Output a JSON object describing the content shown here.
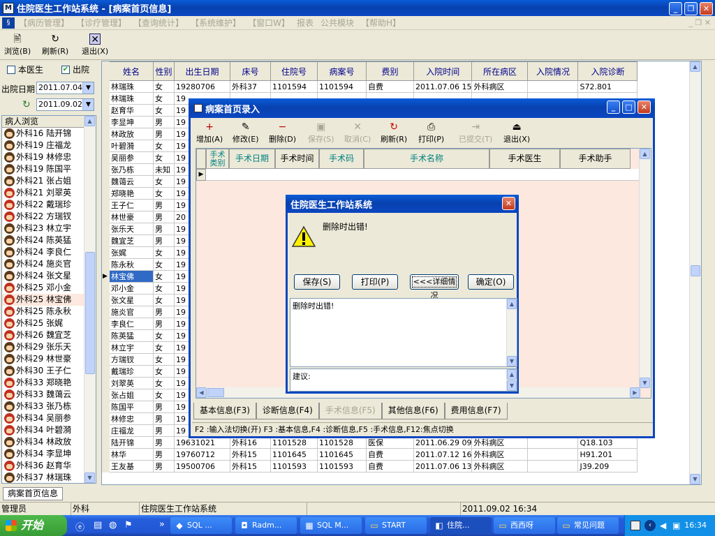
{
  "app": {
    "title": "住院医生工作站系统 - [病案首页信息]",
    "menu": [
      "【病历管理】",
      "【诊疗管理】",
      "【查询统计】",
      "【系统维护】",
      "【窗口W】",
      "报表",
      "公共模块",
      "【帮助H】"
    ],
    "toolbar": [
      {
        "label": "浏览(B)",
        "icon": "browse-icon"
      },
      {
        "label": "刷新(R)",
        "icon": "refresh-icon"
      },
      {
        "label": "退出(X)",
        "icon": "exit-icon"
      }
    ]
  },
  "filter": {
    "doctor_label": "本医生",
    "discharge_label": "出院",
    "date_label": "出院日期",
    "date_from": "2011.07.04",
    "date_to": "2011.09.02"
  },
  "patient_list": {
    "header": "病人浏览",
    "items": [
      {
        "text": "外科16 陆开锦",
        "f": false
      },
      {
        "text": "外科19 庄福龙",
        "f": false
      },
      {
        "text": "外科19 林修忠",
        "f": false
      },
      {
        "text": "外科19 陈国平",
        "f": false
      },
      {
        "text": "外科21 张占姐",
        "f": false
      },
      {
        "text": "外科21 刘翠英",
        "f": true
      },
      {
        "text": "外科22 戴瑞珍",
        "f": true
      },
      {
        "text": "外科22 方瑞钗",
        "f": true
      },
      {
        "text": "外科23 林立宇",
        "f": false
      },
      {
        "text": "外科24 陈英猛",
        "f": false
      },
      {
        "text": "外科24 李良仁",
        "f": false
      },
      {
        "text": "外科24 施炎官",
        "f": false
      },
      {
        "text": "外科24 张文星",
        "f": false
      },
      {
        "text": "外科25 邓小金",
        "f": true
      },
      {
        "text": "外科25 林宝佛",
        "f": true
      },
      {
        "text": "外科25 陈永秋",
        "f": true
      },
      {
        "text": "外科25 张娓",
        "f": true
      },
      {
        "text": "外科26 魏宜芝",
        "f": true
      },
      {
        "text": "外科29 张乐天",
        "f": false
      },
      {
        "text": "外科29 林世豪",
        "f": false
      },
      {
        "text": "外科30 王子仁",
        "f": false
      },
      {
        "text": "外科33 郑晓艳",
        "f": true
      },
      {
        "text": "外科33 魏蔼云",
        "f": true
      },
      {
        "text": "外科33 张乃栋",
        "f": false
      },
      {
        "text": "外科34 吴丽参",
        "f": true
      },
      {
        "text": "外科34 叶碧漪",
        "f": true
      },
      {
        "text": "外科34 林政放",
        "f": false
      },
      {
        "text": "外科34 李显坤",
        "f": false
      },
      {
        "text": "外科36 赵育华",
        "f": true
      },
      {
        "text": "外科37 林瑞珠",
        "f": false
      }
    ]
  },
  "grid": {
    "columns": [
      "姓名",
      "性别",
      "出生日期",
      "床号",
      "住院号",
      "病案号",
      "费别",
      "入院时间",
      "所在病区",
      "入院情况",
      "入院诊断"
    ],
    "selected_index": 14,
    "rows": [
      [
        "林瑞珠",
        "女",
        "19280706",
        "外科37",
        "1101594",
        "1101594",
        "自费",
        "2011.07.06 15",
        "外科病区",
        "",
        "S72.801"
      ],
      [
        "林瑞珠",
        "女",
        "19",
        "",
        "",
        "",
        "",
        "",
        "",
        "",
        ""
      ],
      [
        "赵育华",
        "女",
        "19",
        "",
        "",
        "",
        "",
        "",
        "",
        "",
        ""
      ],
      [
        "李显坤",
        "男",
        "19",
        "",
        "",
        "",
        "",
        "",
        "",
        "",
        ""
      ],
      [
        "林政放",
        "男",
        "19",
        "",
        "",
        "",
        "",
        "",
        "",
        "",
        ""
      ],
      [
        "叶碧漪",
        "女",
        "19",
        "",
        "",
        "",
        "",
        "",
        "",
        "",
        ""
      ],
      [
        "吴丽参",
        "女",
        "19",
        "",
        "",
        "",
        "",
        "",
        "",
        "",
        ""
      ],
      [
        "张乃栋",
        "未知",
        "19",
        "",
        "",
        "",
        "",
        "",
        "",
        "",
        ""
      ],
      [
        "魏蔼云",
        "女",
        "19",
        "",
        "",
        "",
        "",
        "",
        "",
        "",
        ""
      ],
      [
        "郑晓艳",
        "女",
        "19",
        "",
        "",
        "",
        "",
        "",
        "",
        "",
        ""
      ],
      [
        "王子仁",
        "男",
        "19",
        "",
        "",
        "",
        "",
        "",
        "",
        "",
        ""
      ],
      [
        "林世豪",
        "男",
        "20",
        "",
        "",
        "",
        "",
        "",
        "",
        "",
        ""
      ],
      [
        "张乐天",
        "男",
        "19",
        "",
        "",
        "",
        "",
        "",
        "",
        "",
        ""
      ],
      [
        "魏宜芝",
        "男",
        "19",
        "",
        "",
        "",
        "",
        "",
        "",
        "",
        ""
      ],
      [
        "张娓",
        "女",
        "19",
        "",
        "",
        "",
        "",
        "",
        "",
        "",
        ""
      ],
      [
        "陈永秋",
        "女",
        "19",
        "",
        "",
        "",
        "",
        "",
        "",
        "",
        ""
      ],
      [
        "林宝佛",
        "女",
        "19",
        "",
        "",
        "",
        "",
        "",
        "",
        "",
        ""
      ],
      [
        "邓小金",
        "女",
        "19",
        "",
        "",
        "",
        "",
        "",
        "",
        "",
        ""
      ],
      [
        "张文星",
        "女",
        "19",
        "",
        "",
        "",
        "",
        "",
        "",
        "",
        ""
      ],
      [
        "施炎官",
        "男",
        "19",
        "",
        "",
        "",
        "",
        "",
        "",
        "",
        ""
      ],
      [
        "李良仁",
        "男",
        "19",
        "",
        "",
        "",
        "",
        "",
        "",
        "",
        ""
      ],
      [
        "陈英猛",
        "女",
        "19",
        "",
        "",
        "",
        "",
        "",
        "",
        "",
        ""
      ],
      [
        "林立宇",
        "女",
        "19",
        "",
        "",
        "",
        "",
        "",
        "",
        "",
        ""
      ],
      [
        "方瑞钗",
        "女",
        "19",
        "",
        "",
        "",
        "",
        "",
        "",
        "",
        ""
      ],
      [
        "戴瑞珍",
        "女",
        "19",
        "",
        "",
        "",
        "",
        "",
        "",
        "",
        ""
      ],
      [
        "刘翠英",
        "女",
        "19",
        "",
        "",
        "",
        "",
        "",
        "",
        "",
        ""
      ],
      [
        "张占姐",
        "女",
        "19",
        "",
        "",
        "",
        "",
        "",
        "",
        "",
        ""
      ],
      [
        "陈国平",
        "男",
        "19",
        "",
        "",
        "",
        "",
        "",
        "",
        "",
        ""
      ],
      [
        "林修忠",
        "男",
        "19",
        "",
        "",
        "",
        "",
        "",
        "",
        "",
        ""
      ],
      [
        "庄福龙",
        "男",
        "19",
        "",
        "",
        "",
        "",
        "",
        "",
        "",
        ""
      ],
      [
        "陆开锦",
        "男",
        "19631021",
        "外科16",
        "1101528",
        "1101528",
        "医保",
        "2011.06.29 09",
        "外科病区",
        "",
        "Q18.103"
      ],
      [
        "林华",
        "男",
        "19760712",
        "外科15",
        "1101645",
        "1101645",
        "自费",
        "2011.07.12 16",
        "外科病区",
        "",
        "H91.201"
      ],
      [
        "王友基",
        "男",
        "19500706",
        "外科15",
        "1101593",
        "1101593",
        "自费",
        "2011.07.06 13",
        "外科病区",
        "",
        "J39.209"
      ]
    ]
  },
  "inner_window": {
    "title": "病案首页录入",
    "toolbar": [
      {
        "label": "增加(A)",
        "icon": "add-icon",
        "enabled": true
      },
      {
        "label": "修改(E)",
        "icon": "edit-icon",
        "enabled": true
      },
      {
        "label": "删除(D)",
        "icon": "delete-icon",
        "enabled": true
      },
      {
        "label": "保存(S)",
        "icon": "save-icon",
        "enabled": false
      },
      {
        "label": "取消(C)",
        "icon": "cancel-icon",
        "enabled": false
      },
      {
        "label": "刷新(R)",
        "icon": "refresh-icon",
        "enabled": true
      },
      {
        "label": "打印(P)",
        "icon": "print-icon",
        "enabled": true
      },
      {
        "label": "已提交(T)",
        "icon": "submit-icon",
        "enabled": false
      },
      {
        "label": "退出(X)",
        "icon": "exit-icon",
        "enabled": true
      }
    ],
    "columns": [
      "手术类别",
      "手术日期",
      "手术时间",
      "手术码",
      "手术名称",
      "手术医生",
      "手术助手"
    ],
    "tabs": [
      {
        "label": "基本信息(F3)",
        "enabled": true
      },
      {
        "label": "诊断信息(F4)",
        "enabled": true
      },
      {
        "label": "手术信息(F5)",
        "enabled": false
      },
      {
        "label": "其他信息(F6)",
        "enabled": true
      },
      {
        "label": "费用信息(F7)",
        "enabled": true
      }
    ],
    "status": "F2 :输入法切换(开) F3 :基本信息,F4 :诊断信息,F5 :手术信息,F12:焦点切换"
  },
  "dialog": {
    "title": "住院医生工作站系统",
    "message": "删除时出错!",
    "buttons": [
      "保存(S)",
      "打印(P)",
      "<<<详细情况",
      "确定(O)"
    ],
    "detail": "删除时出错!",
    "suggestion_label": "建议:"
  },
  "bottom_tab": "病案首页信息",
  "statusbar": [
    "管理员",
    "外科",
    "住院医生工作站系统",
    "",
    "2011.09.02 16:34"
  ],
  "taskbar": {
    "start": "开始",
    "tasks": [
      {
        "label": "SQL ...",
        "icon": "sql-icon"
      },
      {
        "label": "Radm...",
        "icon": "radmin-icon"
      },
      {
        "label": "SQL M...",
        "icon": "sql-manager-icon"
      },
      {
        "label": "START",
        "icon": "folder-icon"
      },
      {
        "label": "住院...",
        "icon": "app-icon",
        "active": true
      },
      {
        "label": "西西呀",
        "icon": "folder-icon"
      },
      {
        "label": "常见问题",
        "icon": "folder-icon"
      }
    ],
    "clock": "16:34"
  },
  "colors": {
    "accent": "#0A46C0",
    "selection": "#316AC5",
    "grid_header_text": "#00008B",
    "inner_grid_bg": "#FCE8DE"
  }
}
